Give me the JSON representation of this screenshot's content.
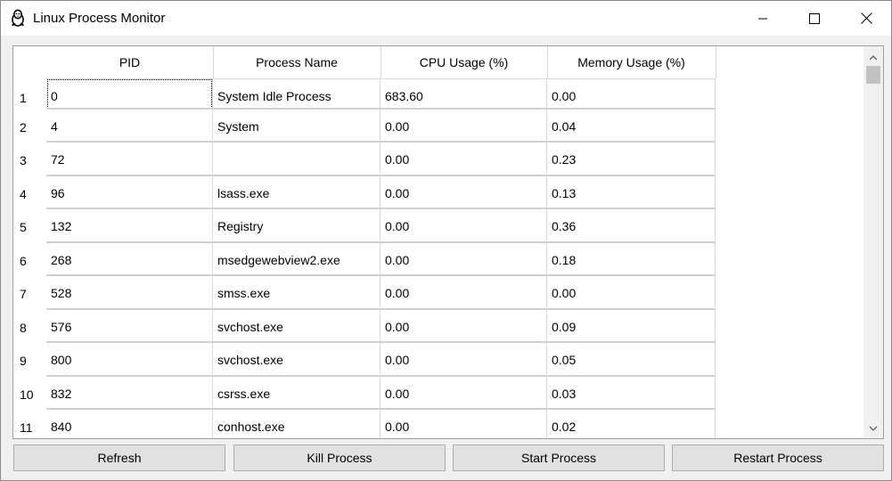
{
  "window": {
    "title": "Linux Process Monitor",
    "icon": "linux-penguin-icon",
    "controls": [
      "minimize-icon",
      "maximize-icon",
      "close-icon"
    ]
  },
  "table": {
    "columns": [
      "PID",
      "Process Name",
      "CPU Usage (%)",
      "Memory Usage (%)"
    ],
    "rows": [
      {
        "num": "1",
        "pid": "0",
        "name": "System Idle Process",
        "cpu": "683.60",
        "mem": "0.00"
      },
      {
        "num": "2",
        "pid": "4",
        "name": "System",
        "cpu": "0.00",
        "mem": "0.04"
      },
      {
        "num": "3",
        "pid": "72",
        "name": "",
        "cpu": "0.00",
        "mem": "0.23"
      },
      {
        "num": "4",
        "pid": "96",
        "name": "lsass.exe",
        "cpu": "0.00",
        "mem": "0.13"
      },
      {
        "num": "5",
        "pid": "132",
        "name": "Registry",
        "cpu": "0.00",
        "mem": "0.36"
      },
      {
        "num": "6",
        "pid": "268",
        "name": "msedgewebview2.exe",
        "cpu": "0.00",
        "mem": "0.18"
      },
      {
        "num": "7",
        "pid": "528",
        "name": "smss.exe",
        "cpu": "0.00",
        "mem": "0.00"
      },
      {
        "num": "8",
        "pid": "576",
        "name": "svchost.exe",
        "cpu": "0.00",
        "mem": "0.09"
      },
      {
        "num": "9",
        "pid": "800",
        "name": "svchost.exe",
        "cpu": "0.00",
        "mem": "0.05"
      },
      {
        "num": "10",
        "pid": "832",
        "name": "csrss.exe",
        "cpu": "0.00",
        "mem": "0.03"
      },
      {
        "num": "11",
        "pid": "840",
        "name": "conhost.exe",
        "cpu": "0.00",
        "mem": "0.02"
      }
    ]
  },
  "buttons": {
    "refresh": "Refresh",
    "kill": "Kill Process",
    "start": "Start Process",
    "restart": "Restart Process"
  }
}
